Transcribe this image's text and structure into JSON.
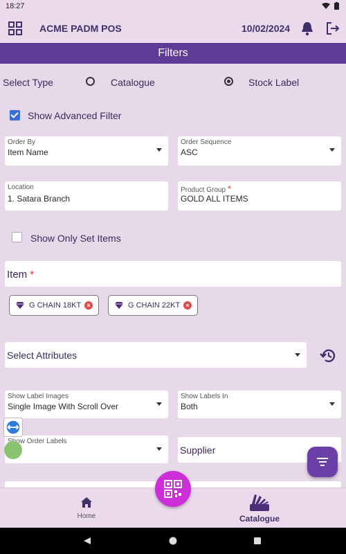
{
  "status": {
    "time": "18:27"
  },
  "appbar": {
    "title": "ACME PADM POS",
    "date": "10/02/2024"
  },
  "filters_title": "Filters",
  "select_type": {
    "label": "Select Type",
    "options": [
      "Catalogue",
      "Stock Label"
    ],
    "selected": "Stock Label"
  },
  "advanced_filter": {
    "label": "Show Advanced Filter",
    "checked": true
  },
  "order_by": {
    "caption": "Order By",
    "value": "Item Name"
  },
  "order_sequence": {
    "caption": "Order Sequence",
    "value": "ASC"
  },
  "location": {
    "caption": "Location",
    "value": "1. Satara Branch"
  },
  "product_group": {
    "caption": "Product Group",
    "required_mark": "*",
    "value": "GOLD ALL ITEMS"
  },
  "set_items": {
    "label": "Show Only Set Items",
    "checked": false
  },
  "item": {
    "label": "Item",
    "required_mark": "*",
    "chips": [
      "G CHAIN 18KT",
      "G CHAIN 22KT"
    ]
  },
  "attributes": {
    "placeholder": "Select Attributes"
  },
  "label_images": {
    "caption": "Show Label Images",
    "value": "Single Image With Scroll Over"
  },
  "labels_in": {
    "caption": "Show Labels In",
    "value": "Both"
  },
  "order_labels": {
    "caption": "Show Order Labels",
    "value": "No"
  },
  "supplier": {
    "placeholder": "Supplier"
  },
  "bottom_nav": {
    "home": "Home",
    "catalogue": "Catalogue"
  },
  "colors": {
    "accent": "#5e3b94",
    "background": "#e8d9ea",
    "qr_button": "#cc2fd8",
    "required": "#e0302f"
  }
}
